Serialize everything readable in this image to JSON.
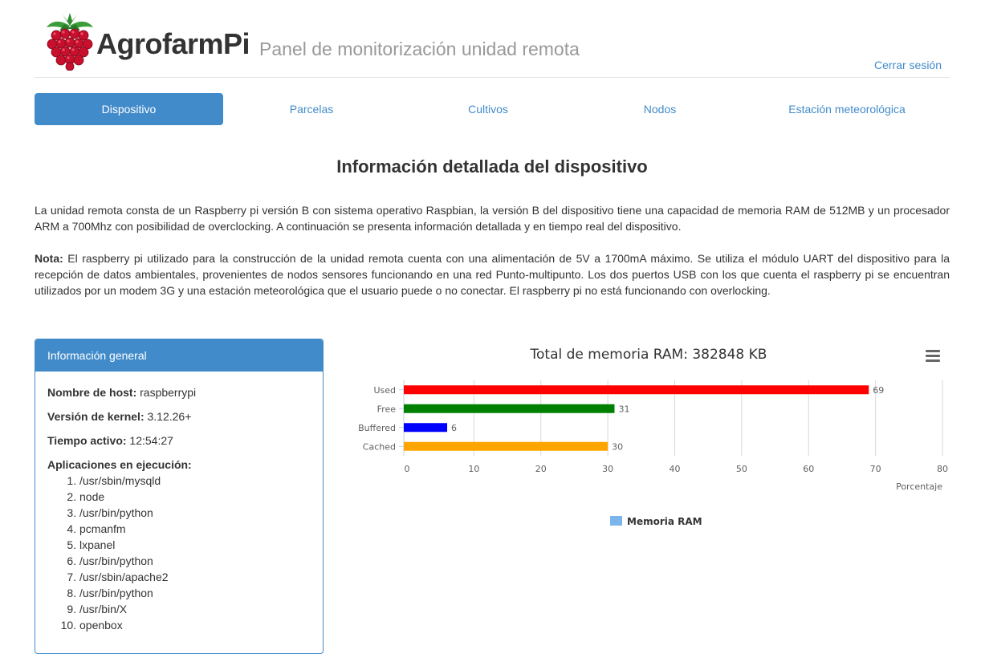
{
  "header": {
    "brand": "AgrofarmPi",
    "subtitle": "Panel de monitorización unidad remota",
    "logout_label": "Cerrar sesión"
  },
  "nav": {
    "items": [
      {
        "label": "Dispositivo",
        "active": true
      },
      {
        "label": "Parcelas",
        "active": false
      },
      {
        "label": "Cultivos",
        "active": false
      },
      {
        "label": "Nodos",
        "active": false
      },
      {
        "label": "Estación meteorológica",
        "active": false
      }
    ]
  },
  "main": {
    "title": "Información detallada del dispositivo",
    "intro": "La unidad remota consta de un Raspberry pi versión B con sistema operativo Raspbian, la versión B del dispositivo tiene una capacidad de memoria RAM de 512MB y un procesador ARM a 700Mhz con posibilidad de overclocking. A continuación se presenta información detallada y en tiempo real del dispositivo.",
    "note_label": "Nota:",
    "note_text": " El raspberry pi utilizado para la construcción de la unidad remota cuenta con una alimentación de 5V a 1700mA máximo. Se utiliza el módulo UART del dispositivo para la recepción de datos ambientales, provenientes de nodos sensores funcionando en una red Punto-multipunto. Los dos puertos USB con los que cuenta el raspberry pi se encuentran utilizados por un modem 3G y una estación meteorológica que el usuario puede o no conectar. El raspberry pi no está funcionando con overlocking."
  },
  "panel": {
    "heading": "Información general",
    "hostname_label": "Nombre de host:",
    "hostname_value": " raspberrypi",
    "kernel_label": "Versión de kernel:",
    "kernel_value": " 3.12.26+",
    "uptime_label": "Tiempo activo:",
    "uptime_value": " 12:54:27",
    "apps_label": "Aplicaciones en ejecución:",
    "apps": [
      "/usr/sbin/mysqld",
      "node",
      "/usr/bin/python",
      "pcmanfm",
      "lxpanel",
      "/usr/bin/python",
      "/usr/sbin/apache2",
      "/usr/bin/python",
      "/usr/bin/X",
      "openbox"
    ]
  },
  "chart_data": {
    "type": "bar",
    "orientation": "horizontal",
    "title": "Total de memoria RAM: 382848 KB",
    "categories": [
      "Used",
      "Free",
      "Buffered",
      "Cached"
    ],
    "values": [
      69,
      31,
      6,
      30
    ],
    "bar_colors": [
      "#ff0000",
      "#008000",
      "#0000ff",
      "#ffa500"
    ],
    "xlabel": "Porcentaje",
    "xlim": [
      0,
      80
    ],
    "ticks": [
      0,
      10,
      20,
      30,
      40,
      50,
      60,
      70,
      80
    ],
    "data_labels": true,
    "grid": true,
    "legend": {
      "position": "bottom-center",
      "entries": [
        {
          "name": "Memoria RAM",
          "color": "#7cb5ec"
        }
      ]
    }
  }
}
